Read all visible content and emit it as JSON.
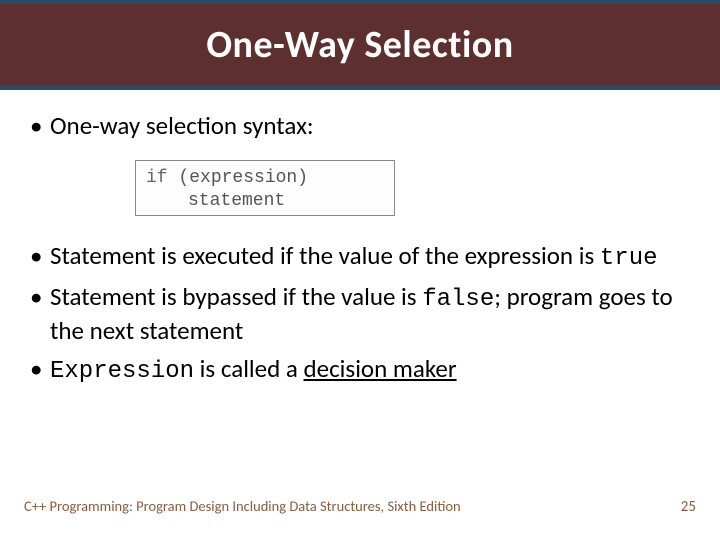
{
  "title": "One-Way Selection",
  "bullets_top": [
    "One-way selection syntax:"
  ],
  "code": {
    "line1_kw": "if",
    "line1_rest": " (expression)",
    "line2": "statement"
  },
  "bullets_bottom": [
    {
      "pre": "Statement is executed if the value of the expression is ",
      "mono": "true",
      "post": ""
    },
    {
      "pre": "Statement is bypassed if the value is ",
      "mono": "false",
      "post": "; program goes to the next statement"
    },
    {
      "pre": "",
      "mono": "Expression",
      "post": " is called a ",
      "underlined": "decision maker"
    }
  ],
  "footer": {
    "book": "C++ Programming: Program Design Including Data Structures, Sixth Edition",
    "page": "25"
  }
}
